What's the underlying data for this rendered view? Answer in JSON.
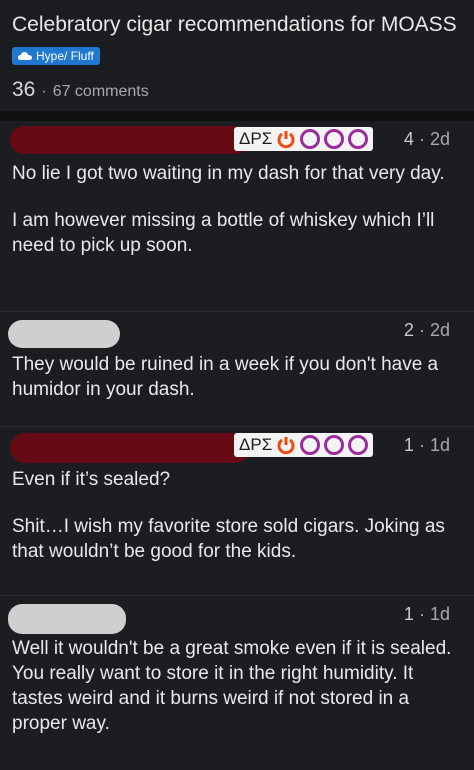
{
  "post": {
    "title": "Celebratory cigar recommendations for MOASS",
    "flair": "Hype/ Fluff",
    "score": "36",
    "comments_label": "67 comments"
  },
  "comments": [
    {
      "flair_text": "ΔPΣ",
      "votes": "4",
      "age": "2d",
      "paragraphs": [
        "No lie I got two waiting in my dash for that very day.",
        "I am however missing a bottle of whiskey which I’ll need to pick up soon."
      ]
    },
    {
      "votes": "2",
      "age": "2d",
      "paragraphs": [
        "They would be ruined in a week if you don't have a humidor in your dash."
      ]
    },
    {
      "flair_text": "ΔPΣ",
      "votes": "1",
      "age": "1d",
      "paragraphs": [
        "Even if it’s sealed?",
        "Shit…I wish my favorite store sold cigars. Joking as that wouldn’t be good for the kids."
      ]
    },
    {
      "votes": "1",
      "age": "1d",
      "paragraphs": [
        "Well it wouldn't be a great smoke even if it is sealed. You really want to store it in the right humidity. It tastes weird and it burns weird if not stored in a proper way."
      ]
    }
  ],
  "colors": {
    "background": "#1b1d20",
    "flair_bg": "#1f77d0",
    "redaction_red": "#650a14",
    "redaction_gray": "#cfcfcf",
    "power_icon": "#f04a13",
    "ring_icon": "#9a2c9e"
  },
  "icons": [
    "cloud-icon",
    "power-icon",
    "ring-icon"
  ]
}
